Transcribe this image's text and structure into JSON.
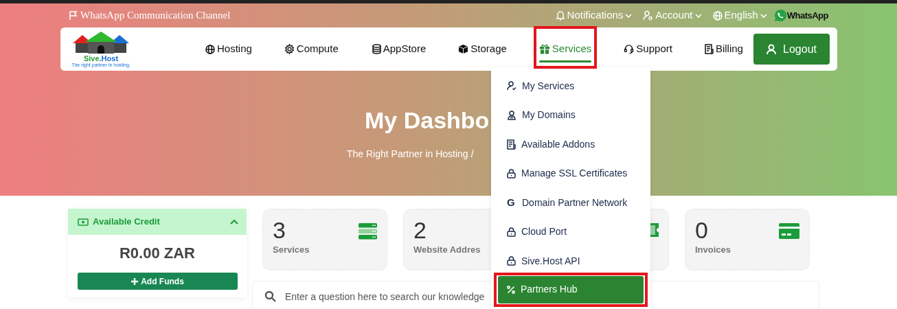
{
  "top_bar": {
    "channel_link": "WhatsApp Communication Channel",
    "menus": [
      {
        "label": "Notifications"
      },
      {
        "label": "Account"
      },
      {
        "label": "English"
      }
    ],
    "whatsapp": "WhatsApp"
  },
  "logo": {
    "name_part1": "Sive",
    "name_part2": ".Host",
    "tagline": "The right partner in hosting."
  },
  "nav": {
    "items": [
      {
        "label": "Hosting",
        "selected": false,
        "highlighted": false
      },
      {
        "label": "Compute",
        "selected": false,
        "highlighted": false
      },
      {
        "label": "AppStore",
        "selected": false,
        "highlighted": false
      },
      {
        "label": "Storage",
        "selected": false,
        "highlighted": false
      },
      {
        "label": "Services",
        "selected": true,
        "highlighted": true
      },
      {
        "label": "Support",
        "selected": false,
        "highlighted": false
      },
      {
        "label": "Billing",
        "selected": false,
        "highlighted": false
      }
    ],
    "logout": "Logout"
  },
  "services_menu": {
    "items": [
      {
        "label": "My Services",
        "selected": false,
        "highlighted": false
      },
      {
        "label": "My Domains",
        "selected": false,
        "highlighted": false
      },
      {
        "label": "Available Addons",
        "selected": false,
        "highlighted": false
      },
      {
        "label": "Manage SSL Certificates",
        "selected": false,
        "highlighted": false
      },
      {
        "label": "Domain Partner Network",
        "icon_char": "G",
        "selected": false,
        "highlighted": false
      },
      {
        "label": "Cloud Port",
        "selected": false,
        "highlighted": false
      },
      {
        "label": "Sive.Host API",
        "selected": false,
        "highlighted": false
      },
      {
        "label": "Partners Hub",
        "selected": true,
        "highlighted": true
      }
    ]
  },
  "hero": {
    "title": "My Dashbo",
    "breadcrumb": "The Right Partner in Hosting",
    "separator": "/"
  },
  "credit": {
    "title": "Available Credit",
    "expanded": true,
    "amount": "R0.00 ZAR",
    "button": "Add Funds"
  },
  "stats": [
    {
      "kind": "server",
      "value": "3",
      "label": "Services"
    },
    {
      "kind": "plain",
      "value": "2",
      "label": "Website Addres"
    },
    {
      "kind": "ticket"
    },
    {
      "kind": "card",
      "value": "0",
      "label": "Invoices"
    }
  ],
  "search": {
    "placeholder": "Enter a question here to search our knowledge"
  }
}
